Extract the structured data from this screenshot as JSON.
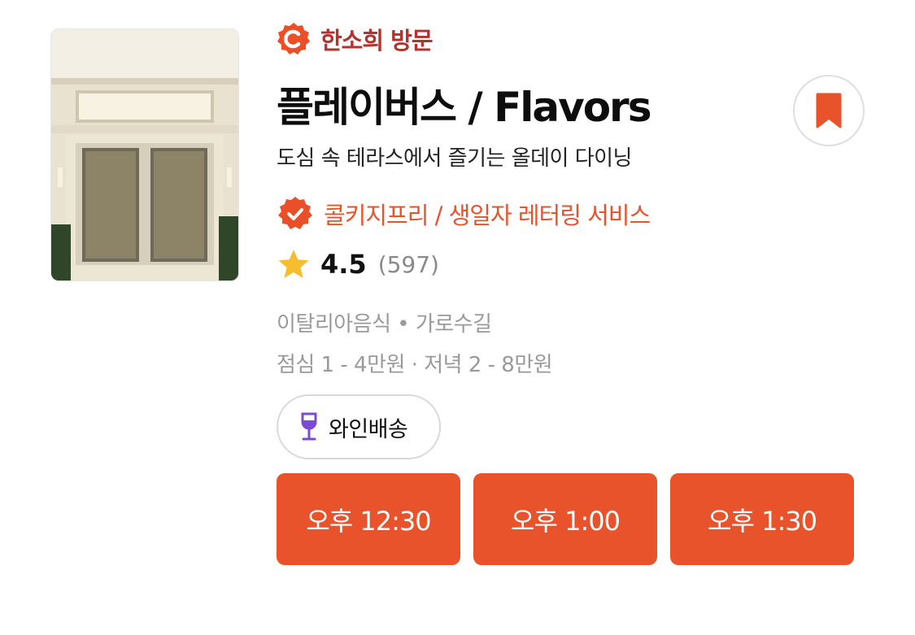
{
  "restaurant": {
    "image_alt": "Flavors",
    "visit_badge": "한소희 방문",
    "name": "플레이버스 / Flavors",
    "description": "도심 속 테라스에서 즐기는 올데이 다이닝",
    "perks": "콜키지프리 / 생일자 레터링 서비스",
    "rating": "4.5",
    "review_count": "(597)",
    "category_line": "이탈리아음식 • 가로수길",
    "price_line": "점심 1 - 4만원 · 저녁 2 - 8만원",
    "tag": "와인배송"
  },
  "icons": {
    "visit": "c-badge-icon",
    "perk": "verified-check-icon",
    "rating": "star-icon",
    "tag": "wine-glass-icon",
    "bookmark": "bookmark-icon"
  },
  "time_slots": [
    "오후 12:30",
    "오후 1:00",
    "오후 1:30"
  ],
  "colors": {
    "accent": "#e9532b",
    "visit_text": "#b2322d",
    "star": "#f5bd2f",
    "wine": "#7b4bd6",
    "muted": "#9a9a9a"
  }
}
